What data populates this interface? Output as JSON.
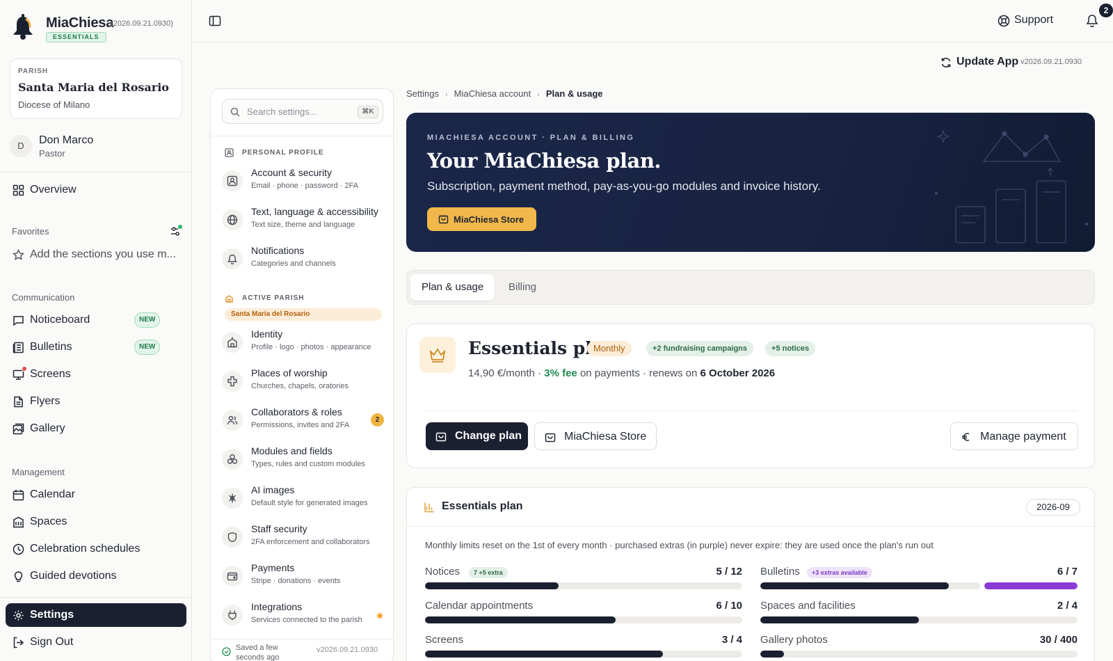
{
  "app": {
    "name": "MiaChiesa",
    "version": "(2026.09.21.0930)",
    "tier": "ESSENTIALS"
  },
  "parish": {
    "label": "PARISH",
    "name": "Santa Maria del Rosario",
    "diocese": "Diocese of Milano"
  },
  "user": {
    "initial": "D",
    "name": "Don Marco",
    "role": "Pastor"
  },
  "nav": {
    "overview": "Overview",
    "favorites_title": "Favorites",
    "favorites_hint": "Add the sections you use m...",
    "communication_title": "Communication",
    "communication": [
      {
        "label": "Noticeboard",
        "badge": "NEW"
      },
      {
        "label": "Bulletins",
        "badge": "NEW"
      },
      {
        "label": "Screens"
      },
      {
        "label": "Flyers"
      },
      {
        "label": "Gallery"
      }
    ],
    "management_title": "Management",
    "management": [
      {
        "label": "Calendar"
      },
      {
        "label": "Spaces"
      },
      {
        "label": "Celebration schedules"
      },
      {
        "label": "Guided devotions"
      }
    ],
    "settings": "Settings",
    "signout": "Sign Out"
  },
  "topbar": {
    "support": "Support",
    "notifications": "2",
    "update_label": "Update App",
    "update_version": "v2026.09.21.0930"
  },
  "settings_panel": {
    "search_placeholder": "Search settings...",
    "search_shortcut": "⌘K",
    "personal_title": "PERSONAL PROFILE",
    "personal": [
      {
        "title": "Account & security",
        "sub": "Email · phone · password · 2FA"
      },
      {
        "title": "Text, language & accessibility",
        "sub": "Text size, theme and language"
      },
      {
        "title": "Notifications",
        "sub": "Categories and channels"
      }
    ],
    "parish_title": "ACTIVE PARISH",
    "parish_chip": "Santa Maria del Rosario",
    "parish_items": [
      {
        "title": "Identity",
        "sub": "Profile · logo · photos · appearance"
      },
      {
        "title": "Places of worship",
        "sub": "Churches, chapels, oratories"
      },
      {
        "title": "Collaborators & roles",
        "sub": "Permissions, invites and 2FA",
        "count": "2"
      },
      {
        "title": "Modules and fields",
        "sub": "Types, rules and custom modules"
      },
      {
        "title": "AI images",
        "sub": "Default style for generated images"
      },
      {
        "title": "Staff security",
        "sub": "2FA enforcement and collaborators"
      },
      {
        "title": "Payments",
        "sub": "Stripe · donations · events"
      },
      {
        "title": "Integrations",
        "sub": "Services connected to the parish"
      }
    ],
    "saved": "Saved a few seconds ago",
    "version": "v2026.09.21.0930"
  },
  "breadcrumb": [
    "Settings",
    "MiaChiesa account",
    "Plan & usage"
  ],
  "hero": {
    "kicker": "MIACHIESA ACCOUNT · PLAN & BILLING",
    "title": "Your MiaChiesa plan.",
    "subtitle": "Subscription, payment method, pay-as-you-go modules and invoice history.",
    "store_button": "MiaChiesa Store"
  },
  "tabs": [
    "Plan & usage",
    "Billing"
  ],
  "plan": {
    "name": "Essentials plan",
    "cycle": "Monthly",
    "extra1": "+2 fundraising campaigns",
    "extra2": "+5 notices",
    "price": "14,90 €/month",
    "sep1": " · ",
    "fee": "3% fee",
    "fee_suffix": " on payments · renews on ",
    "renew_date": "6 October 2026",
    "change_button": "Change plan",
    "store_button": "MiaChiesa Store",
    "payment_button": "Manage payment"
  },
  "usage": {
    "title": "Essentials plan",
    "month": "2026-09",
    "note": "Monthly limits reset on the 1st of every month · purchased extras (in purple) never expire: they are used once the plan's run out",
    "metrics": [
      {
        "label": "Notices",
        "chip": "7 +5 extra",
        "chip_color": "green",
        "value": "5 / 12",
        "fraction": 0.42
      },
      {
        "label": "Bulletins",
        "chip": "+3 extras available",
        "chip_color": "purple",
        "value": "6 / 7",
        "fraction": 0.857,
        "extra_fraction": 1.0
      },
      {
        "label": "Calendar appointments",
        "value": "6 / 10",
        "fraction": 0.6
      },
      {
        "label": "Spaces and facilities",
        "value": "2 / 4",
        "fraction": 0.5
      },
      {
        "label": "Screens",
        "value": "3 / 4",
        "fraction": 0.75
      },
      {
        "label": "Gallery photos",
        "value": "30 / 400",
        "fraction": 0.075
      }
    ]
  },
  "colors": {
    "primary": "#1b2030",
    "accent": "#f1b74a",
    "extra": "#8a3bd6",
    "success": "#1f8a4e"
  }
}
